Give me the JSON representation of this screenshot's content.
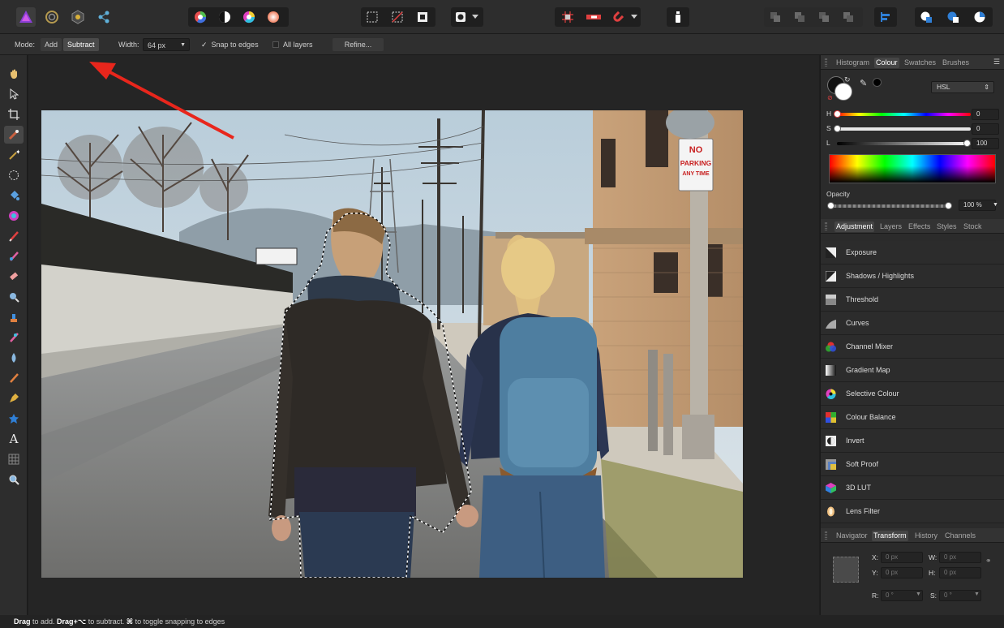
{
  "context_toolbar": {
    "mode_label": "Mode:",
    "add_label": "Add",
    "subtract_label": "Subtract",
    "width_label": "Width:",
    "width_value": "64 px",
    "snap_label": "Snap to edges",
    "snap_checked": true,
    "all_layers_label": "All layers",
    "all_layers_checked": false,
    "refine_label": "Refine..."
  },
  "photo": {
    "sign_line1": "NO",
    "sign_line2": "PARKING",
    "sign_line3": "ANY TIME"
  },
  "colour_panel": {
    "tabs": [
      "Histogram",
      "Colour",
      "Swatches",
      "Brushes"
    ],
    "active_tab": "Colour",
    "model": "HSL",
    "h_label": "H",
    "h_value": "0",
    "s_label": "S",
    "s_value": "0",
    "l_label": "L",
    "l_value": "100",
    "opacity_label": "Opacity",
    "opacity_value": "100 %"
  },
  "adjustment_panel": {
    "tabs": [
      "Adjustment",
      "Layers",
      "Effects",
      "Styles",
      "Stock"
    ],
    "active_tab": "Adjustment",
    "items": [
      {
        "label": "Exposure",
        "icon": "exposure-icon"
      },
      {
        "label": "Shadows / Highlights",
        "icon": "shadows-highlights-icon"
      },
      {
        "label": "Threshold",
        "icon": "threshold-icon"
      },
      {
        "label": "Curves",
        "icon": "curves-icon"
      },
      {
        "label": "Channel Mixer",
        "icon": "channel-mixer-icon"
      },
      {
        "label": "Gradient Map",
        "icon": "gradient-map-icon"
      },
      {
        "label": "Selective Colour",
        "icon": "selective-colour-icon"
      },
      {
        "label": "Colour Balance",
        "icon": "colour-balance-icon"
      },
      {
        "label": "Invert",
        "icon": "invert-icon"
      },
      {
        "label": "Soft Proof",
        "icon": "soft-proof-icon"
      },
      {
        "label": "3D LUT",
        "icon": "3d-lut-icon"
      },
      {
        "label": "Lens Filter",
        "icon": "lens-filter-icon"
      }
    ]
  },
  "transform_panel": {
    "tabs": [
      "Navigator",
      "Transform",
      "History",
      "Channels"
    ],
    "active_tab": "Transform",
    "x_label": "X:",
    "x_value": "0 px",
    "y_label": "Y:",
    "y_value": "0 px",
    "w_label": "W:",
    "w_value": "0 px",
    "h_label": "H:",
    "h_value": "0 px",
    "r_label": "R:",
    "r_value": "0 °",
    "s_label": "S:",
    "s_value": "0 °"
  },
  "status_bar": {
    "drag1": "Drag",
    "text1": " to add. ",
    "drag2": "Drag",
    "key2": "+⌥",
    "text2": " to subtract. ",
    "key3": "⌘",
    "text3": " to toggle snapping to edges"
  },
  "colors": {
    "accent_blue": "#2f7fd6",
    "annotation_red": "#e8261c",
    "photo_sky": "#c9d6df"
  }
}
